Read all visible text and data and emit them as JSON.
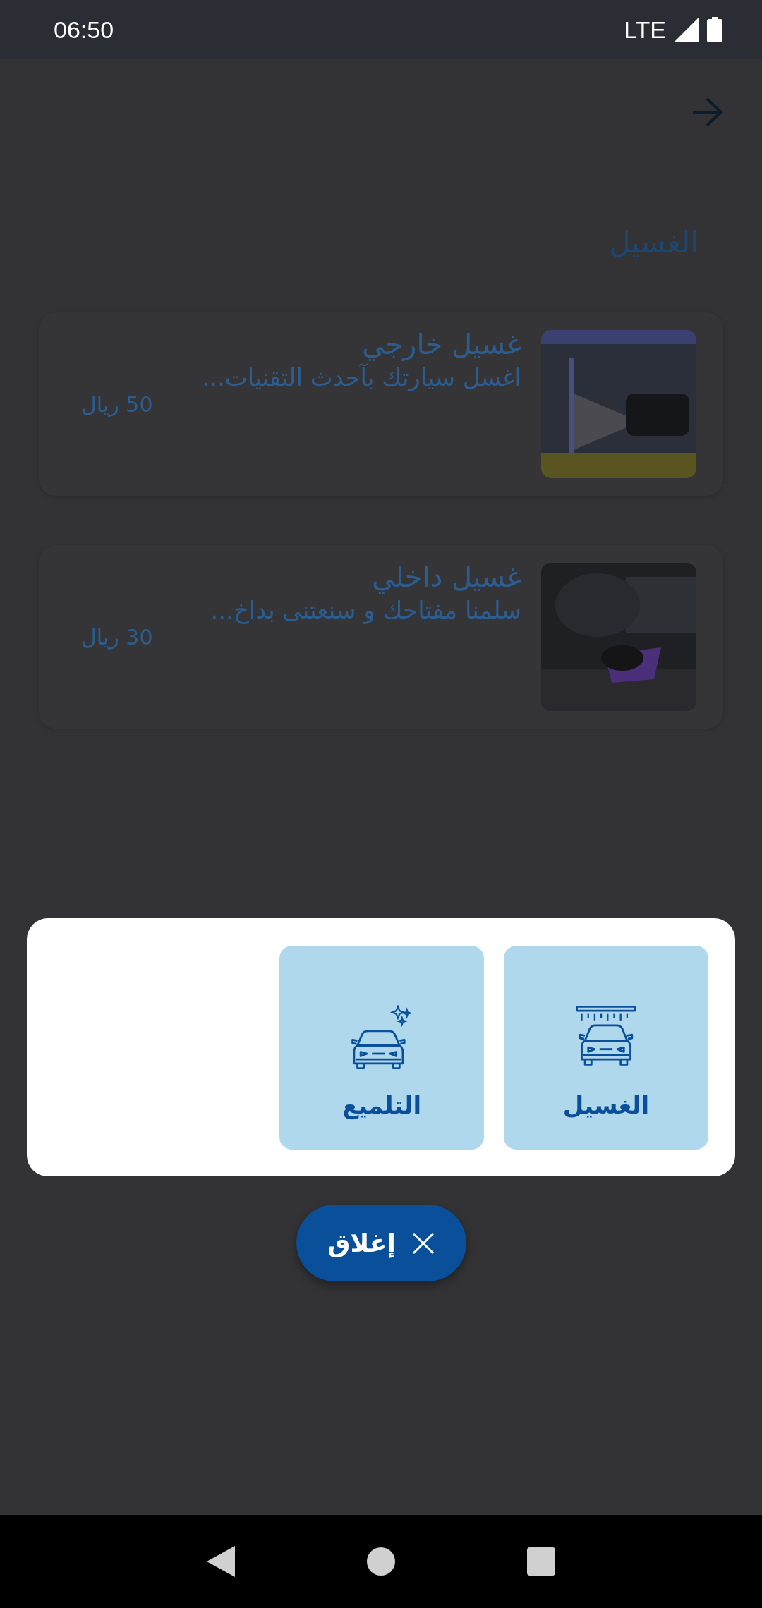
{
  "status_bar": {
    "time": "06:50",
    "network": "LTE"
  },
  "header": {
    "title": "الغسيل"
  },
  "services": [
    {
      "title": "غسيل خارجي",
      "description": "اغسل سيارتك بآحدث التقنيات...",
      "price": "50 ريال"
    },
    {
      "title": "غسيل داخلي",
      "description": "سلمنا مفتاحك و سنعتنى بداخ...",
      "price": "30 ريال"
    }
  ],
  "dialog": {
    "options": [
      {
        "label": "الغسيل",
        "kind": "wash"
      },
      {
        "label": "التلميع",
        "kind": "polish"
      }
    ],
    "close_button": "إغلاق"
  }
}
